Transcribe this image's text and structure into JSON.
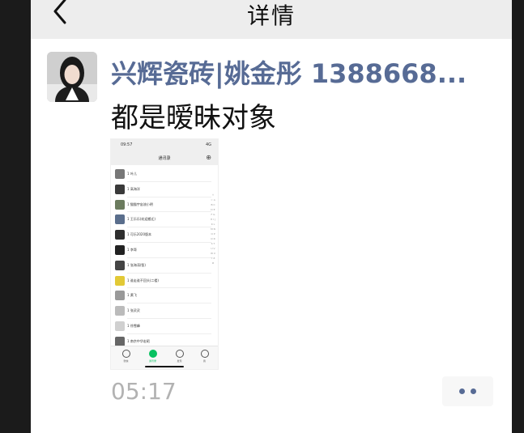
{
  "navbar": {
    "title": "详情"
  },
  "post": {
    "author": "兴辉瓷砖|姚金彤 1388668...",
    "text": "都是暧昧对象",
    "time": "05:17"
  },
  "screenshot": {
    "status_time": "09:57",
    "status_signal": "4G",
    "title": "通讯录",
    "contacts": [
      {
        "name": "1 叶儿",
        "color": "#777777"
      },
      {
        "name": "1 高海洋",
        "color": "#3a3a3a"
      },
      {
        "name": "1 猫猫宇宙流小明",
        "color": "#6b7b5e"
      },
      {
        "name": "1 王乐乐(欢迎搬迁)",
        "color": "#5a6e8c"
      },
      {
        "name": "1 可乐2020版本",
        "color": "#2e2e2e"
      },
      {
        "name": "1 李哥",
        "color": "#222222"
      },
      {
        "name": "1 张海涛(智)",
        "color": "#444444"
      },
      {
        "name": "1 谁走谁不回头(二楼)",
        "color": "#e2c936"
      },
      {
        "name": "1 黄飞",
        "color": "#999999"
      },
      {
        "name": "1 张灵灵",
        "color": "#bbbbbb"
      },
      {
        "name": "1 徐雪峰",
        "color": "#d0d0d0"
      },
      {
        "name": "1 南京中华宏昭",
        "color": "#666666"
      }
    ],
    "index_letters": "↑ ☆ A B C D E F G H I J K L M N O P Q R S T U V W X Y Z #",
    "tabs": [
      {
        "label": "微信",
        "active": false
      },
      {
        "label": "通讯录",
        "active": true
      },
      {
        "label": "发现",
        "active": false
      },
      {
        "label": "我",
        "active": false
      }
    ]
  },
  "colors": {
    "link": "#576b95",
    "nav_bg": "#ededed",
    "time_gray": "#b2b2b2",
    "wechat_green": "#07c160"
  },
  "icons": {
    "back": "chevron-left-icon",
    "more": "more-dots-icon"
  }
}
